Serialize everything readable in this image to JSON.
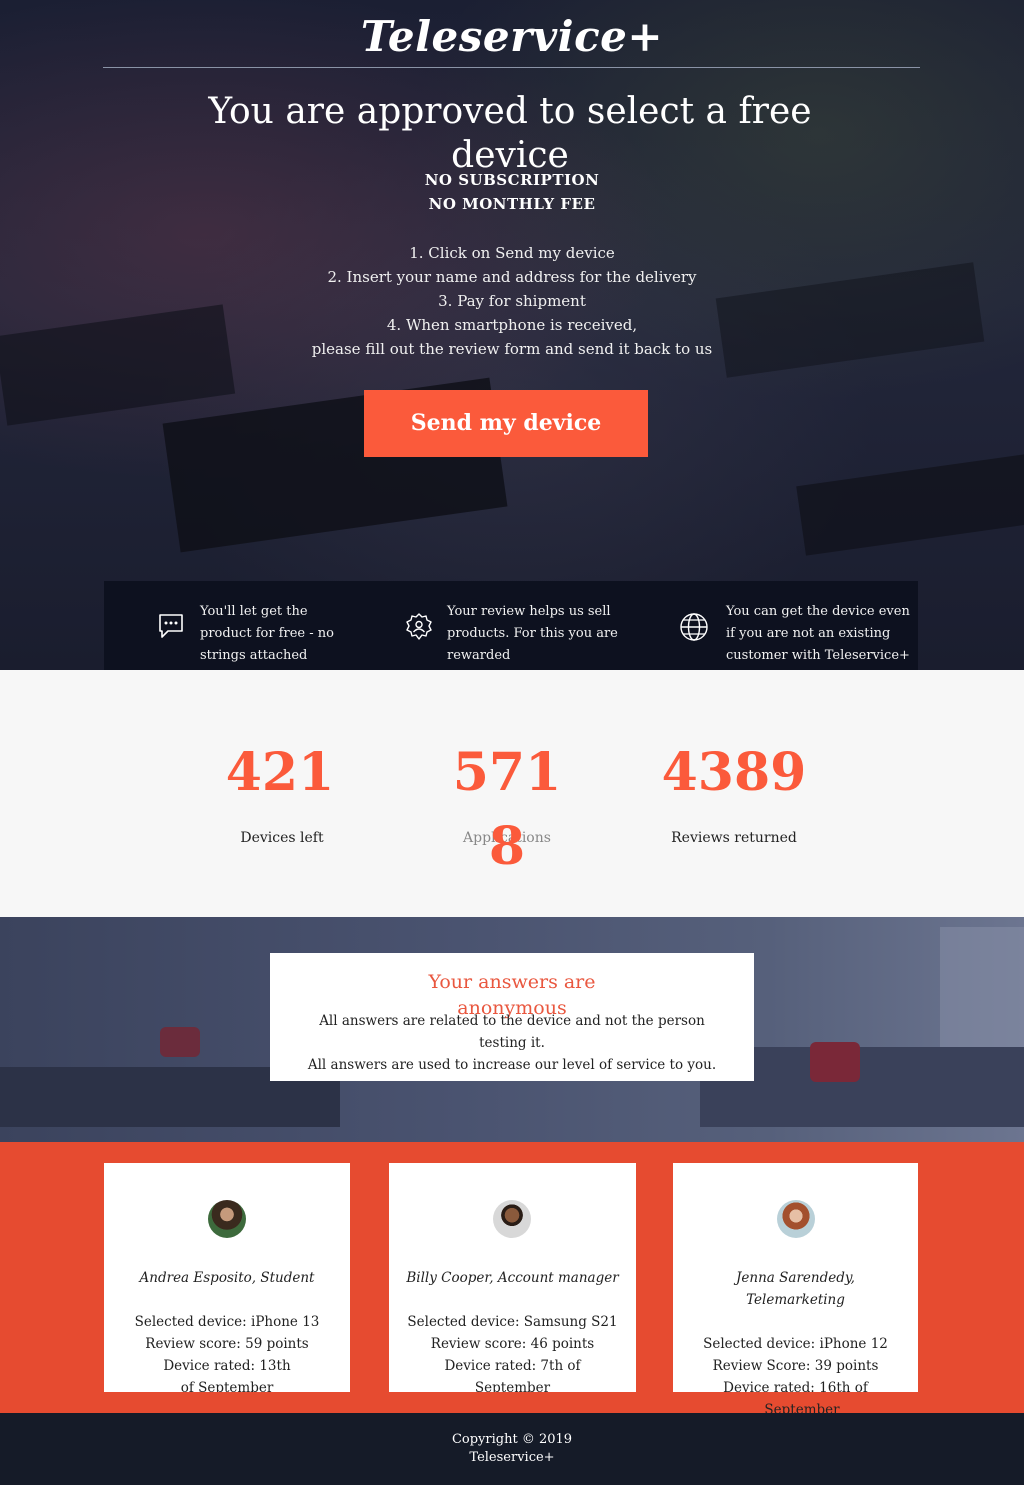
{
  "header": {
    "brand": "Teleservice+"
  },
  "hero": {
    "headline": "You are approved to select a free device",
    "tagline_1": "NO SUBSCRIPTION",
    "tagline_2": "NO MONTHLY FEE",
    "steps": [
      "1. Click on Send my device",
      "2. Insert your name and address for the delivery",
      "3. Pay for shipment",
      "4. When smartphone is received,",
      "please fill out the review form and send it back to us"
    ],
    "cta_label": "Send my device"
  },
  "features": [
    {
      "icon": "chat-bubble-icon",
      "lines": [
        "You'll let get the",
        "product for free - no",
        "strings attached"
      ]
    },
    {
      "icon": "gear-user-icon",
      "lines": [
        "Your review helps us sell",
        "products. For this you are",
        "rewarded"
      ]
    },
    {
      "icon": "globe-icon",
      "lines": [
        "You can get the device even",
        "if you are not an existing",
        "customer with Teleservice+"
      ]
    }
  ],
  "stats": [
    {
      "value": "421",
      "label": "Devices left"
    },
    {
      "value": "5718",
      "label": "Applications"
    },
    {
      "value": "4389",
      "label": "Reviews returned"
    }
  ],
  "anon": {
    "title": "Your answers are anonymous",
    "lines": [
      "All answers are related to the device and not the person",
      "testing it.",
      "All answers are used to increase our level of service to you."
    ]
  },
  "testimonials": [
    {
      "name": "Andrea Esposito, Student",
      "details": [
        "Selected device: iPhone 13",
        "Review score: 59 points",
        "Device rated: 13th",
        "of September"
      ]
    },
    {
      "name": "Billy Cooper, Account manager",
      "details": [
        "Selected device: Samsung S21",
        "Review score: 46 points",
        "Device rated: 7th of",
        "September"
      ]
    },
    {
      "name": "Jenna Sarendedy, Telemarketing",
      "details": [
        "Selected device: iPhone 12",
        "Review Score: 39 points",
        "Device rated: 16th of",
        "September"
      ]
    }
  ],
  "footer": {
    "line1": "Copyright © 2019",
    "line2": "Teleservice+"
  },
  "colors": {
    "accent": "#fb5a3b",
    "testimonial_bg": "#e64b30",
    "footer_bg": "#151b28"
  }
}
